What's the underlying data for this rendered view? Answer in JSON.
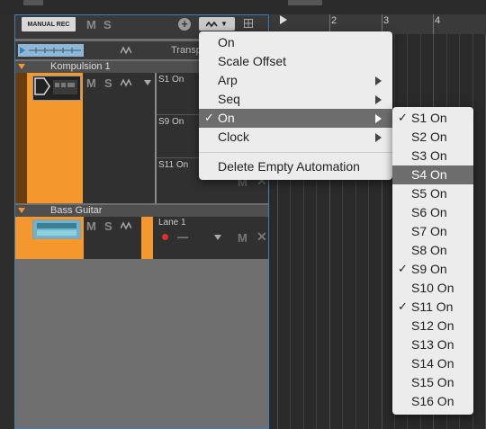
{
  "header": {
    "manual_rec": "MANUAL REC",
    "mute": "M",
    "solo": "S",
    "add_icon": "plus-circle-icon",
    "automation_icon": "automation-wave-icon",
    "grid_icon": "grid-icon"
  },
  "transport": {
    "label": "Transp"
  },
  "tracks": [
    {
      "name": "Kompulsion 1",
      "mute": "M",
      "solo": "S",
      "lanes": [
        "S1 On",
        "S9 On",
        "S11 On"
      ],
      "lane_mute": "M"
    },
    {
      "name": "Bass Guitar",
      "mute": "M",
      "solo": "S",
      "lane": "Lane 1",
      "lane_mute": "M",
      "lane_dash": "—"
    }
  ],
  "ruler": [
    "2",
    "3",
    "4"
  ],
  "menu": [
    {
      "label": "On",
      "checked": false,
      "submenu": false
    },
    {
      "label": "Scale Offset",
      "checked": false,
      "submenu": false
    },
    {
      "label": "Arp",
      "checked": false,
      "submenu": true
    },
    {
      "label": "Seq",
      "checked": false,
      "submenu": true
    },
    {
      "label": "On",
      "checked": true,
      "submenu": true,
      "highlighted": true
    },
    {
      "label": "Clock",
      "checked": false,
      "submenu": true
    },
    {
      "label": "Delete Empty Automation",
      "checked": false,
      "submenu": false
    }
  ],
  "submenu": [
    {
      "label": "S1 On",
      "checked": true
    },
    {
      "label": "S2 On",
      "checked": false
    },
    {
      "label": "S3 On",
      "checked": false
    },
    {
      "label": "S4 On",
      "checked": false,
      "highlighted": true
    },
    {
      "label": "S5 On",
      "checked": false
    },
    {
      "label": "S6 On",
      "checked": false
    },
    {
      "label": "S7 On",
      "checked": false
    },
    {
      "label": "S8 On",
      "checked": false
    },
    {
      "label": "S9 On",
      "checked": true
    },
    {
      "label": "S10 On",
      "checked": false
    },
    {
      "label": "S11 On",
      "checked": true
    },
    {
      "label": "S12 On",
      "checked": false
    },
    {
      "label": "S13 On",
      "checked": false
    },
    {
      "label": "S14 On",
      "checked": false
    },
    {
      "label": "S15 On",
      "checked": false
    },
    {
      "label": "S16 On",
      "checked": false
    }
  ],
  "checkmark": "✓",
  "colors": {
    "track_orange": "#f4982e",
    "panel_outline": "#3f7fb8",
    "menu_highlight": "#6d6d6d"
  }
}
